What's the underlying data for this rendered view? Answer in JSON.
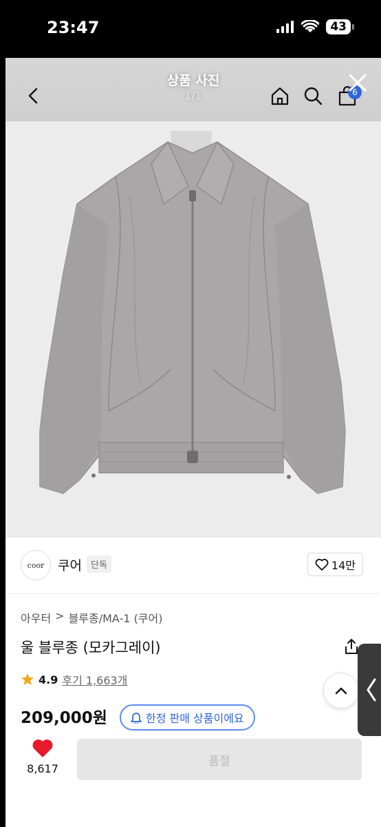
{
  "status_bar": {
    "time": "23:47",
    "battery": "43",
    "icons": [
      "signal-icon",
      "wifi-icon",
      "battery-icon"
    ]
  },
  "header": {
    "title": "상품 사진",
    "count": "1/1",
    "cart_badge": "6",
    "icons": [
      "back-icon",
      "home-icon",
      "search-icon",
      "cart-icon",
      "close-icon"
    ]
  },
  "brand": {
    "logo_text": "coor",
    "name": "쿠어",
    "badge": "단독",
    "like_count": "14만"
  },
  "product": {
    "breadcrumb": [
      "아우터",
      ">",
      "블루종/MA-1 (쿠어)"
    ],
    "name": "울 블루종 (모카그레이)",
    "rating": "4.9",
    "review": "후기 1,663개",
    "price": "209,000원",
    "limited_label": "한정 판매 상품이에요"
  },
  "bottom": {
    "like_count": "8,617",
    "soldout_label": "품절"
  },
  "colors": {
    "accent_blue": "#2f66d8",
    "heart_red": "#e8182d",
    "star_gold": "#f2a81d",
    "jacket_gray": "#a8a6a7"
  }
}
